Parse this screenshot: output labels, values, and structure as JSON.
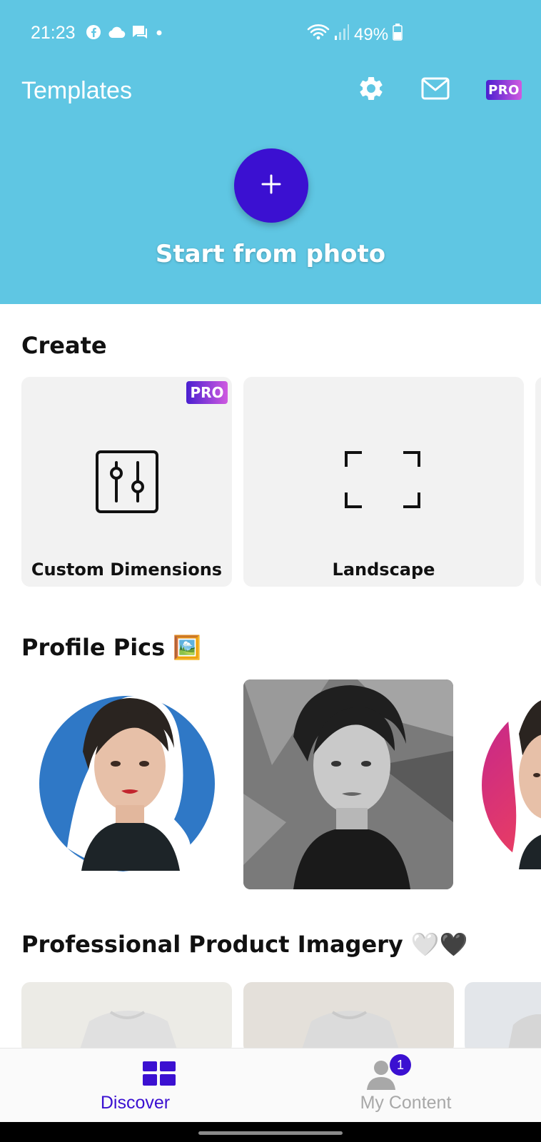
{
  "status": {
    "time": "21:23",
    "battery": "49%"
  },
  "topbar": {
    "title": "Templates",
    "pro_label": "PRO"
  },
  "hero": {
    "start_label": "Start from photo"
  },
  "sections": {
    "create": {
      "title": "Create",
      "cards": [
        {
          "label": "Custom Dimensions",
          "pro": "PRO"
        },
        {
          "label": "Landscape"
        }
      ]
    },
    "profile": {
      "title": "Profile Pics 🖼️"
    },
    "product": {
      "title": "Professional Product Imagery 🤍🖤"
    }
  },
  "bottom_nav": {
    "discover": "Discover",
    "my_content": "My Content",
    "badge": "1"
  },
  "colors": {
    "header_bg": "#5fc6e3",
    "accent": "#3b10d1"
  }
}
